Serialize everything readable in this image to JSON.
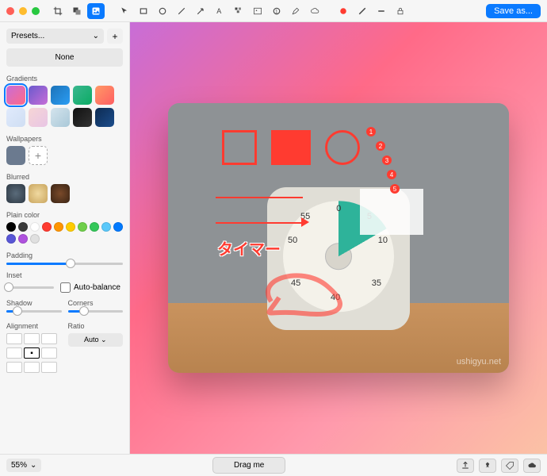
{
  "titlebar": {
    "save_label": "Save as...",
    "tools": [
      "crop",
      "overlay",
      "image-layer",
      "background",
      "pointer",
      "rectangle",
      "oval",
      "oval-fill",
      "line",
      "arrow",
      "text",
      "pixelate",
      "image",
      "counter",
      "pen",
      "cloud",
      "fill-color",
      "stroke",
      "stroke-weight",
      "lock"
    ],
    "fill_color": "#ff3b30"
  },
  "sidebar": {
    "presets_label": "Presets...",
    "none_label": "None",
    "gradients_label": "Gradients",
    "wallpapers_label": "Wallpapers",
    "blurred_label": "Blurred",
    "plain_color_label": "Plain color",
    "plain_colors": [
      "#000000",
      "#3a3a3a",
      "#ffffff",
      "#ff3b30",
      "#ff9500",
      "#ffcc00",
      "#6fcf4a",
      "#34c759",
      "#5ac8fa",
      "#007aff",
      "#5856d6",
      "#af52de",
      "#e0e0e0"
    ],
    "padding_label": "Padding",
    "padding_value": 55,
    "inset_label": "Inset",
    "inset_value": 0,
    "autobalance_label": "Auto-balance",
    "autobalance_checked": false,
    "shadow_label": "Shadow",
    "shadow_value": 20,
    "corners_label": "Corners",
    "corners_value": 30,
    "alignment_label": "Alignment",
    "ratio_label": "Ratio",
    "ratio_value": "Auto"
  },
  "canvas": {
    "annotation_text": "タイマー",
    "watermark": "ushigyu.net",
    "timer_numbers": {
      "top": "0",
      "r1": "5",
      "r2": "10",
      "l1": "55",
      "l2": "50",
      "bl": "45",
      "br": "35",
      "b": "40"
    },
    "badges": [
      "1",
      "2",
      "3",
      "4",
      "5"
    ]
  },
  "footer": {
    "zoom_label": "55%",
    "drag_label": "Drag me"
  }
}
